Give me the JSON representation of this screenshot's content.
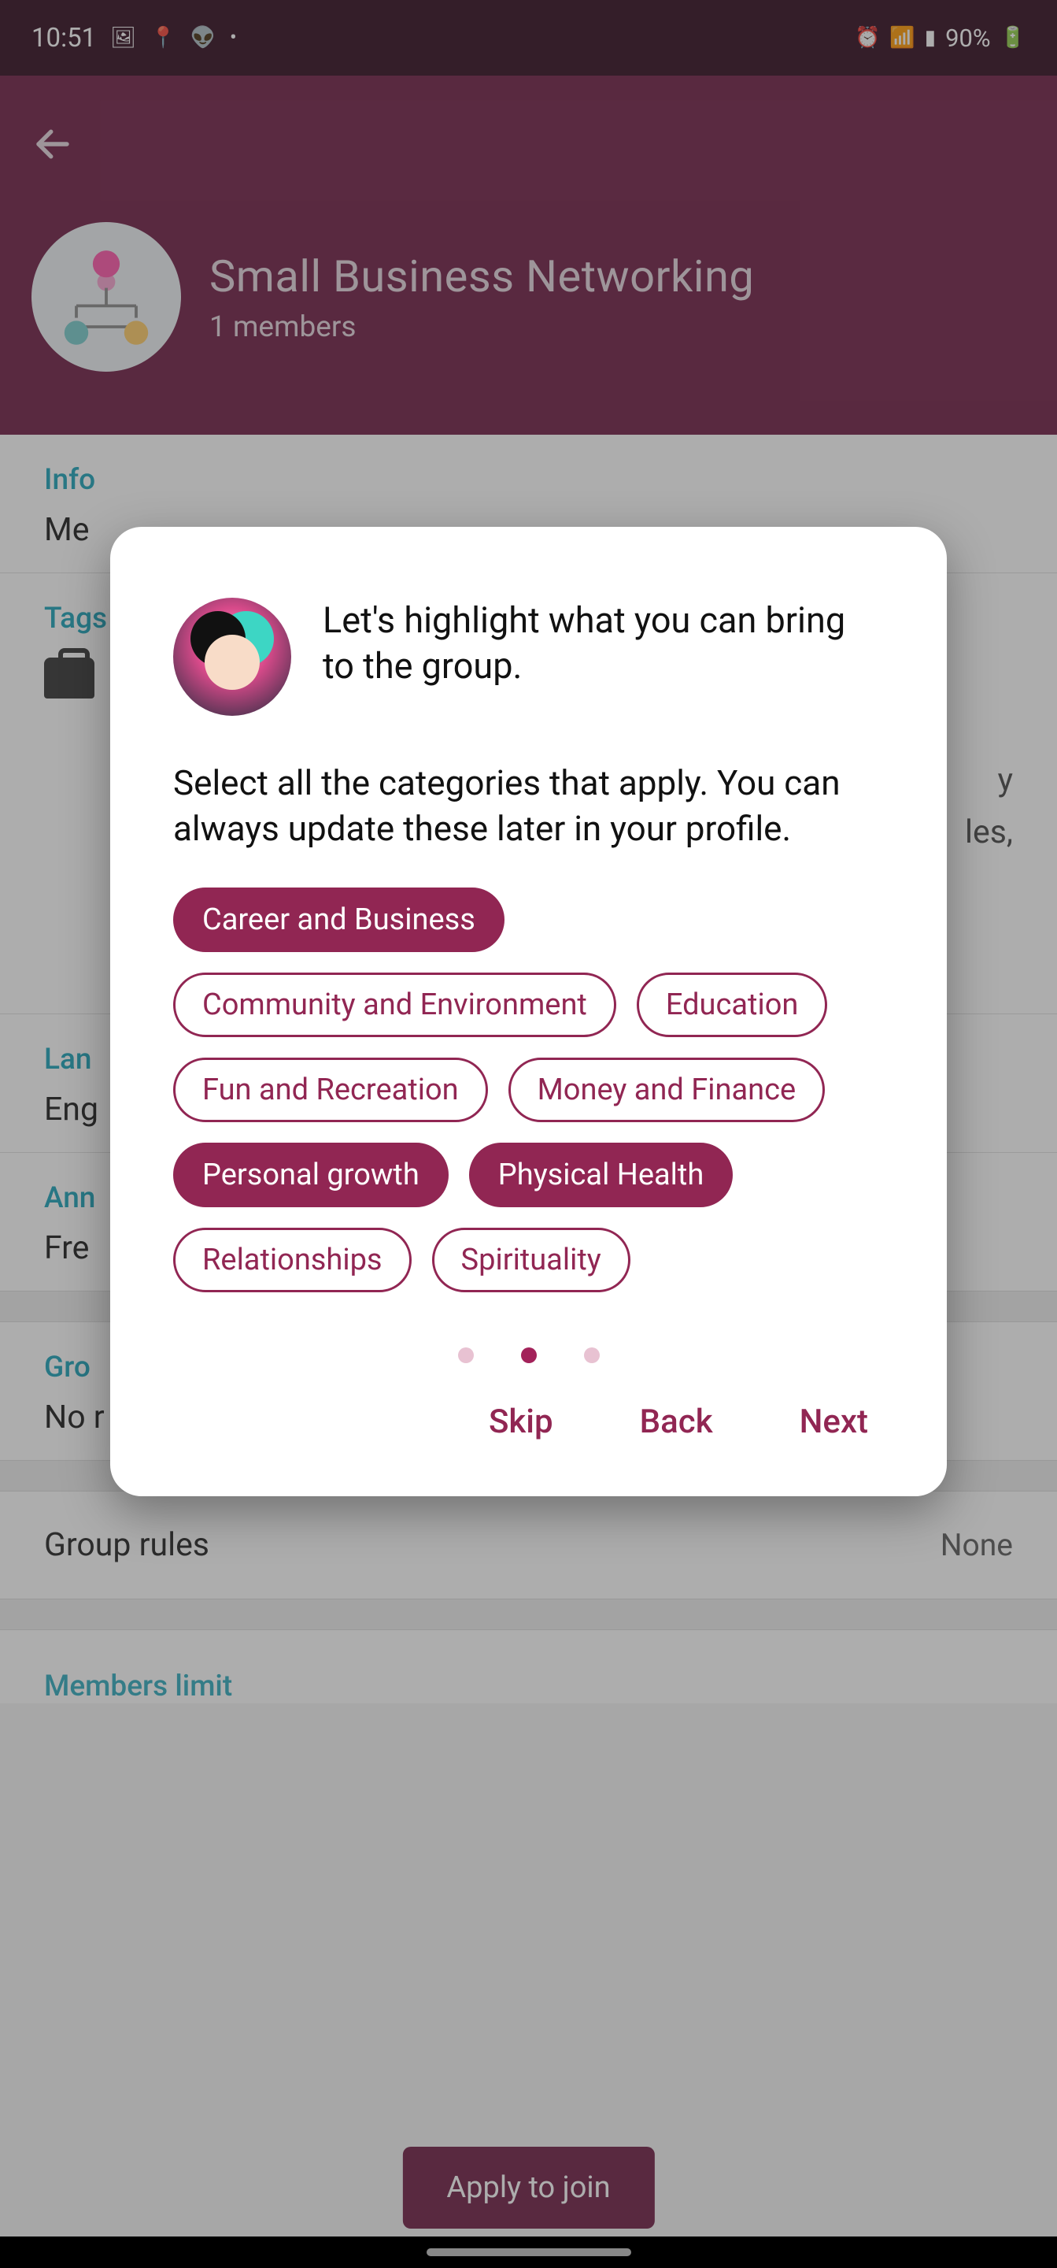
{
  "status_bar": {
    "time": "10:51",
    "battery_text": "90%"
  },
  "header": {
    "title": "Small Business Networking",
    "members": "1 members"
  },
  "sections": {
    "info_label": "Info",
    "info_value_visible": "Me",
    "tags_label": "Tags",
    "obscured_line1": "y",
    "obscured_line2": "les,",
    "language_label": "Lan",
    "language_value_visible": "Eng",
    "fee_label": "Ann",
    "fee_value_visible": "Fre",
    "group_rules_label": "Gro",
    "group_rules_value_visible": "No r",
    "rules_row_label": "Group rules",
    "rules_row_value": "None",
    "members_limit_label": "Members limit"
  },
  "apply_button": "Apply to join",
  "dialog": {
    "title": "Let's highlight what you can bring to the group.",
    "subtitle": "Select all the categories that apply. You can always update these later in your profile.",
    "chips": [
      {
        "label": "Career and Business",
        "selected": true
      },
      {
        "label": "Community and Environment",
        "selected": false
      },
      {
        "label": "Education",
        "selected": false
      },
      {
        "label": "Fun and Recreation",
        "selected": false
      },
      {
        "label": "Money and Finance",
        "selected": false
      },
      {
        "label": "Personal growth",
        "selected": true
      },
      {
        "label": "Physical Health",
        "selected": true
      },
      {
        "label": "Relationships",
        "selected": false
      },
      {
        "label": "Spirituality",
        "selected": false
      }
    ],
    "active_dot_index": 1,
    "dot_count": 3,
    "actions": {
      "skip": "Skip",
      "back": "Back",
      "next": "Next"
    }
  }
}
